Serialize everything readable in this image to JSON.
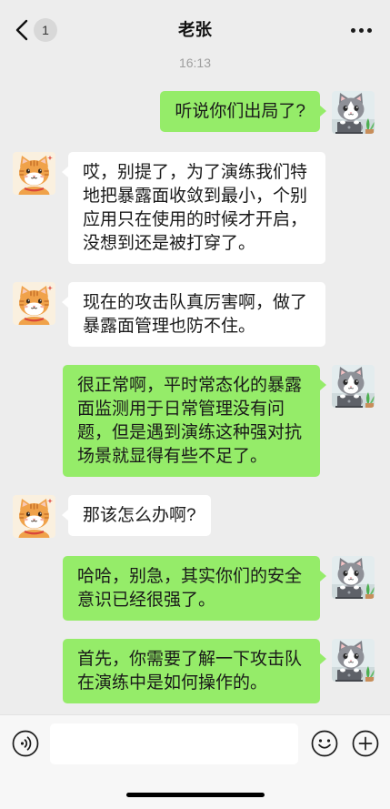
{
  "header": {
    "unread_badge": "1",
    "title": "老张"
  },
  "timestamp": "16:13",
  "messages": [
    {
      "text": "听说你们出局了?",
      "avatar": "gray-cat-avatar"
    },
    {
      "text": "哎，别提了，为了演练我们特地把暴露面收敛到最小，个别应用只在使用的时候才开启，没想到还是被打穿了。",
      "avatar": "orange-cat-avatar"
    },
    {
      "text": "现在的攻击队真厉害啊，做了暴露面管理也防不住。",
      "avatar": "orange-cat-avatar"
    },
    {
      "text": "很正常啊，平时常态化的暴露面监测用于日常管理没有问题，但是遇到演练这种强对抗场景就显得有些不足了。",
      "avatar": "gray-cat-avatar"
    },
    {
      "text": "那该怎么办啊?",
      "avatar": "orange-cat-avatar"
    },
    {
      "text": "哈哈，别急，其实你们的安全意识已经很强了。",
      "avatar": "gray-cat-avatar"
    },
    {
      "text": "首先，你需要了解一下攻击队在演练中是如何操作的。",
      "avatar": "gray-cat-avatar"
    }
  ],
  "input_bar": {
    "message_value": ""
  },
  "icons": {
    "back": "chevron-left-icon",
    "more": "more-dots-icon",
    "voice": "voice-icon",
    "emoji": "emoji-icon",
    "plus": "plus-icon"
  },
  "colors": {
    "chat_background": "#EDEDED",
    "outgoing_bubble": "#95EC69",
    "incoming_bubble": "#FFFFFF",
    "input_bar_background": "#F7F7F7",
    "message_text": "#191919",
    "timestamp_text": "#9E9E9E"
  }
}
